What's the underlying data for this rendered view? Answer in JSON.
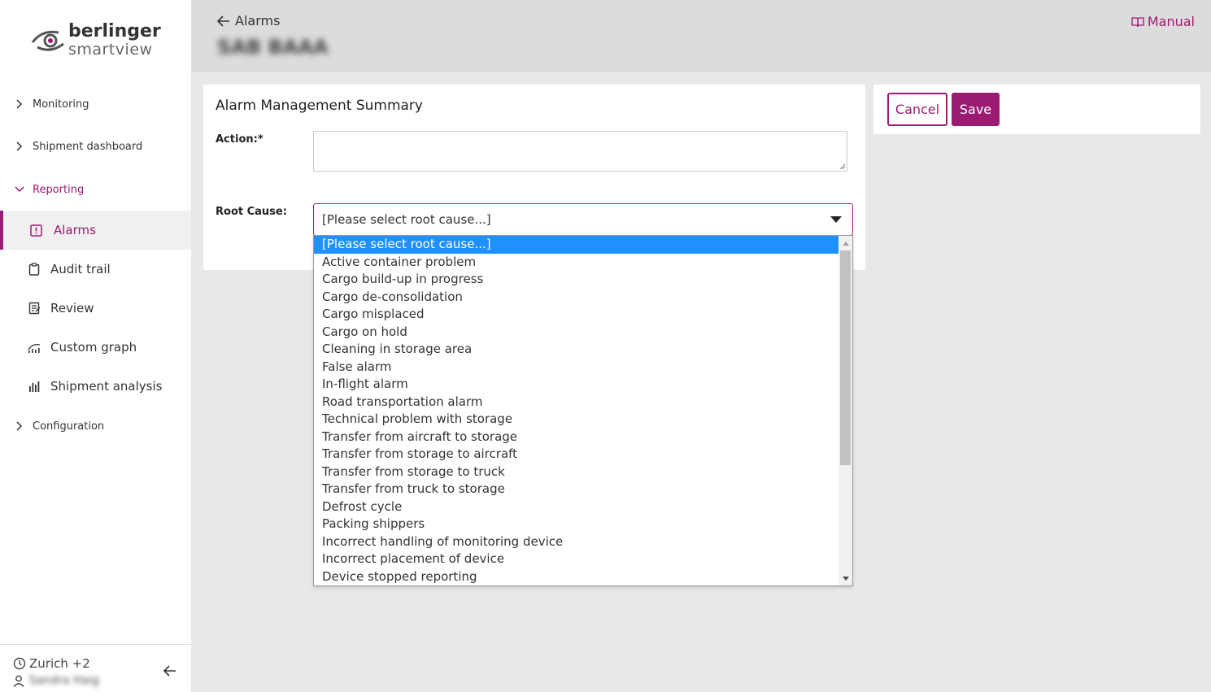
{
  "logo": {
    "brand": "berlinger",
    "product": "smartview"
  },
  "nav": {
    "monitoring": "Monitoring",
    "shipment_dashboard": "Shipment dashboard",
    "reporting": "Reporting",
    "alarms": "Alarms",
    "audit_trail": "Audit trail",
    "review": "Review",
    "custom_graph": "Custom graph",
    "shipment_analysis": "Shipment analysis",
    "configuration": "Configuration"
  },
  "footer": {
    "timezone": "Zurich +2",
    "user": "Sandra Haig"
  },
  "header": {
    "back_label": "Alarms",
    "shipment_title": "SAB BAAA",
    "manual_label": "Manual"
  },
  "form": {
    "title": "Alarm Management Summary",
    "action_label": "Action:*",
    "action_value": "",
    "root_cause_label": "Root Cause:",
    "root_cause_selected": "[Please select root cause...]"
  },
  "buttons": {
    "cancel": "Cancel",
    "save": "Save"
  },
  "root_cause_options": [
    "[Please select root cause...]",
    "Active container problem",
    "Cargo build-up in progress",
    "Cargo de-consolidation",
    "Cargo misplaced",
    "Cargo on hold",
    "Cleaning in storage area",
    "False alarm",
    "In-flight alarm",
    "Road transportation alarm",
    "Technical problem with storage",
    "Transfer from aircraft to storage",
    "Transfer from storage to aircraft",
    "Transfer from storage to truck",
    "Transfer from truck to storage",
    "Defrost cycle",
    "Packing shippers",
    "Incorrect handling of monitoring device",
    "Incorrect placement of device",
    "Device stopped reporting"
  ],
  "colors": {
    "accent": "#9c1b72",
    "highlight": "#1e90ff",
    "header_bg": "#dcdcdc",
    "page_bg": "#e8e8e8"
  }
}
